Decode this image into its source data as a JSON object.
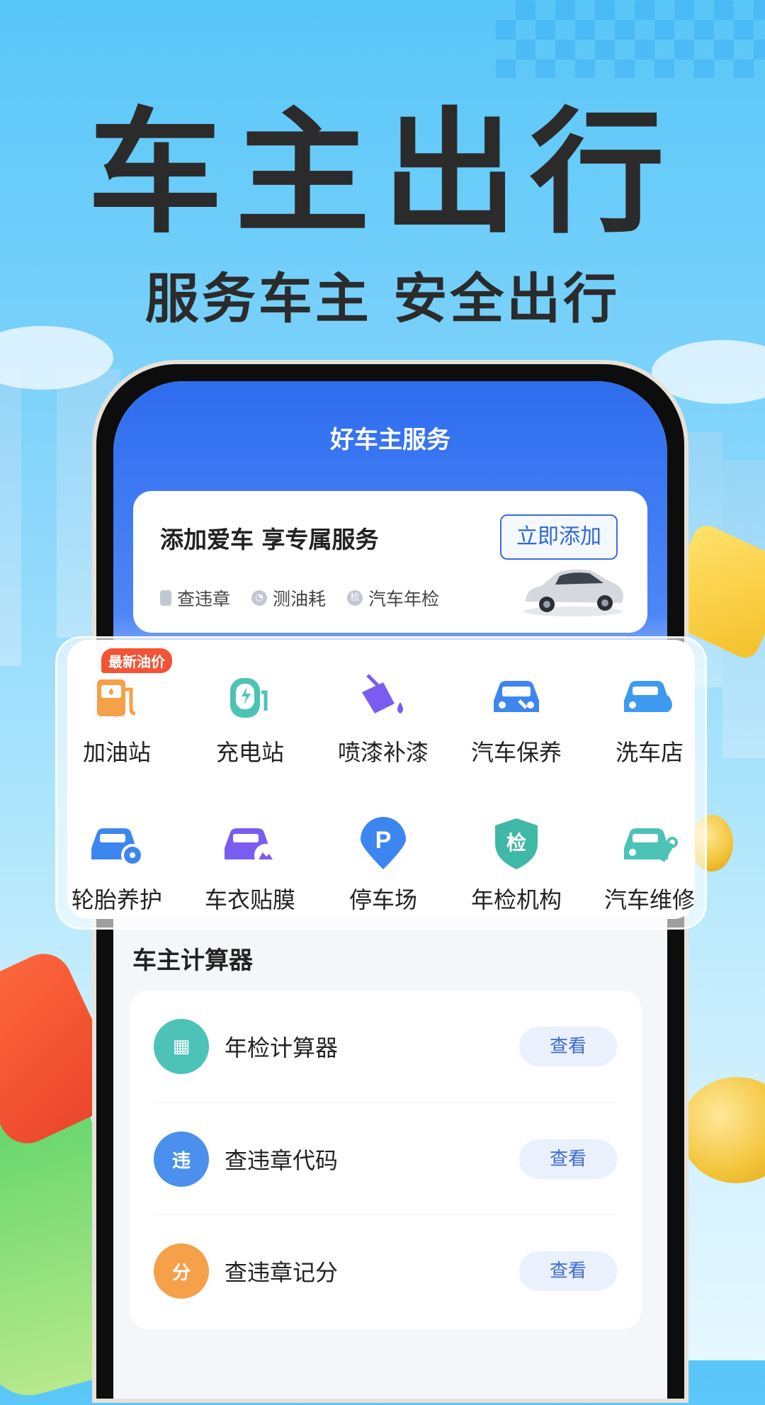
{
  "hero": {
    "title": "车主出行",
    "subtitle": "服务车主 安全出行"
  },
  "app": {
    "screen_title": "好车主服务",
    "add_card": {
      "title": "添加爱车 享专属服务",
      "button": "立即添加",
      "tags": [
        {
          "label": "查违章",
          "icon": "document-icon"
        },
        {
          "label": "测油耗",
          "icon": "gauge-icon"
        },
        {
          "label": "汽车年检",
          "icon": "inspection-shield-icon",
          "icon_text": "检"
        }
      ]
    },
    "services": [
      {
        "label": "加油站",
        "icon": "gas-station-icon",
        "color": "#f6a04a",
        "badge": "最新油价"
      },
      {
        "label": "充电站",
        "icon": "charging-station-icon",
        "color": "#4cc3b6"
      },
      {
        "label": "喷漆补漆",
        "icon": "paint-bucket-icon",
        "color": "#7b5cf0"
      },
      {
        "label": "汽车保养",
        "icon": "car-maintenance-icon",
        "color": "#3d86f0"
      },
      {
        "label": "洗车店",
        "icon": "car-wash-icon",
        "color": "#3d9af0"
      },
      {
        "label": "轮胎养护",
        "icon": "tire-care-icon",
        "color": "#3d86f0"
      },
      {
        "label": "车衣贴膜",
        "icon": "car-film-icon",
        "color": "#7b5cf0"
      },
      {
        "label": "停车场",
        "icon": "parking-icon",
        "color": "#3d86f0",
        "icon_text": "P"
      },
      {
        "label": "年检机构",
        "icon": "inspection-agency-icon",
        "color": "#3fb8a8",
        "icon_text": "检"
      },
      {
        "label": "汽车维修",
        "icon": "car-repair-icon",
        "color": "#4cc3b6"
      }
    ],
    "calculator": {
      "title": "车主计算器",
      "items": [
        {
          "label": "年检计算器",
          "button": "查看",
          "icon": "calculator-icon",
          "color": "#4cc3b6",
          "icon_text": "▦"
        },
        {
          "label": "查违章代码",
          "button": "查看",
          "icon": "violation-code-icon",
          "color": "#4a90ec",
          "icon_text": "违"
        },
        {
          "label": "查违章记分",
          "button": "查看",
          "icon": "violation-score-icon",
          "color": "#f6a04a",
          "icon_text": "分"
        }
      ]
    }
  }
}
